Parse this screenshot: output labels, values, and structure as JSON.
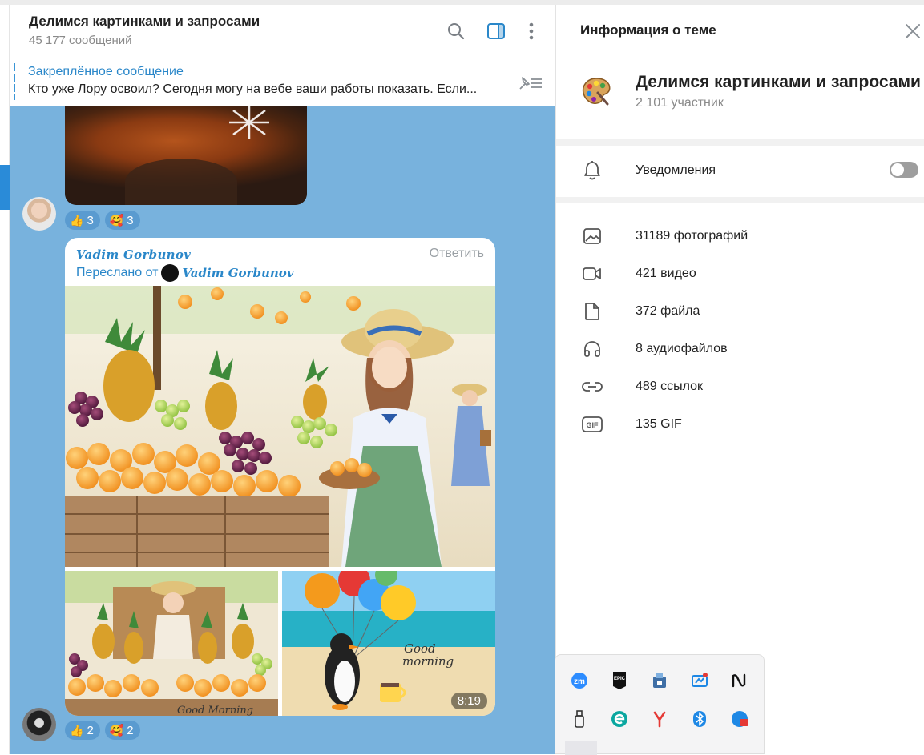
{
  "chat": {
    "title": "Делимся картинками и запросами",
    "message_count": "45 177 сообщений",
    "pinned": {
      "label": "Закреплённое сообщение",
      "text": "Кто уже Лору освоил? Сегодня могу на вебе ваши работы показать. Если..."
    },
    "reactions_1": [
      {
        "emoji": "👍",
        "count": "3"
      },
      {
        "emoji": "🥰",
        "count": "3"
      }
    ],
    "message": {
      "author": "Vadim Gorbunov",
      "reply_label": "Ответить",
      "forwarded_prefix": "Переслано от",
      "forwarded_from": "Vadim Gorbunov",
      "video_duration": "8:19",
      "good_morning_text": "Good morning",
      "strip_text": "Good Morning"
    },
    "reactions_2": [
      {
        "emoji": "👍",
        "count": "2"
      },
      {
        "emoji": "🥰",
        "count": "2"
      }
    ]
  },
  "info": {
    "title": "Информация о теме",
    "group_name": "Делимся картинками и запросами",
    "members": "2 101 участник",
    "notifications_label": "Уведомления",
    "notifications_on": false,
    "media": [
      {
        "icon": "photo-icon",
        "label": "31189 фотографий"
      },
      {
        "icon": "video-icon",
        "label": "421 видео"
      },
      {
        "icon": "file-icon",
        "label": "372 файла"
      },
      {
        "icon": "headphones-icon",
        "label": "8 аудиофайлов"
      },
      {
        "icon": "link-icon",
        "label": "489 ссылок"
      },
      {
        "icon": "gif-icon",
        "label": "135 GIF"
      }
    ]
  },
  "tray": {
    "icons": [
      "zoom-icon",
      "epic-games-icon",
      "network-drive-icon",
      "remote-desktop-icon",
      "notion-icon",
      "usb-drive-icon",
      "eset-icon",
      "yandex-icon",
      "bluetooth-icon",
      "battery-app-icon"
    ],
    "zoom_label": "zm",
    "epic_label": "EPIC",
    "gif_badge": "GIF"
  },
  "colors": {
    "accent": "#2a87c9",
    "chat_background": "#78b2dd",
    "reaction_bg": "#5a9bd0"
  }
}
